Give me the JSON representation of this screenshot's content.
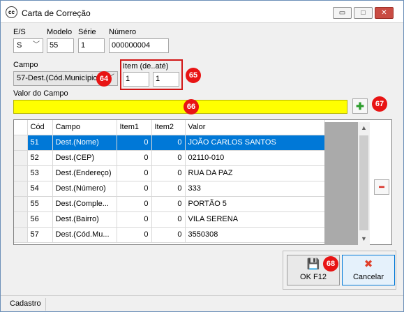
{
  "window": {
    "title": "Carta de Correção",
    "app_icon_text": "cc",
    "minimize_glyph": "▭",
    "maximize_glyph": "□",
    "close_glyph": "✕"
  },
  "header_fields": {
    "es_label": "E/S",
    "es_value": "S",
    "modelo_label": "Modelo",
    "modelo_value": "55",
    "serie_label": "Série",
    "serie_value": "1",
    "numero_label": "Número",
    "numero_value": "000000004"
  },
  "campo": {
    "label": "Campo",
    "value": "57-Dest.(Cód.Município)"
  },
  "item_range": {
    "label": "Item (de..até)",
    "from": "1",
    "to": "1"
  },
  "valor": {
    "label": "Valor do Campo",
    "value": ""
  },
  "badges": {
    "b64": "64",
    "b65": "65",
    "b66": "66",
    "b67": "67",
    "b68": "68"
  },
  "grid": {
    "columns": [
      "Cód",
      "Campo",
      "Item1",
      "Item2",
      "Valor"
    ],
    "rows": [
      {
        "cod": "51",
        "campo": "Dest.(Nome)",
        "item1": "0",
        "item2": "0",
        "valor": "JOÃO CARLOS SANTOS",
        "selected": true
      },
      {
        "cod": "52",
        "campo": "Dest.(CEP)",
        "item1": "0",
        "item2": "0",
        "valor": "02110-010",
        "selected": false
      },
      {
        "cod": "53",
        "campo": "Dest.(Endereço)",
        "item1": "0",
        "item2": "0",
        "valor": "RUA DA PAZ",
        "selected": false
      },
      {
        "cod": "54",
        "campo": "Dest.(Número)",
        "item1": "0",
        "item2": "0",
        "valor": "333",
        "selected": false
      },
      {
        "cod": "55",
        "campo": "Dest.(Comple...",
        "item1": "0",
        "item2": "0",
        "valor": "PORTÃO 5",
        "selected": false
      },
      {
        "cod": "56",
        "campo": "Dest.(Bairro)",
        "item1": "0",
        "item2": "0",
        "valor": "VILA SERENA",
        "selected": false
      },
      {
        "cod": "57",
        "campo": "Dest.(Cód.Mu...",
        "item1": "0",
        "item2": "0",
        "valor": "3550308",
        "selected": false
      }
    ]
  },
  "buttons": {
    "ok_label": "OK  F12",
    "cancel_label": "Cancelar",
    "add_glyph": "✚",
    "remove_glyph": "━",
    "save_glyph": "💾",
    "cancel_glyph": "✖"
  },
  "status_bar": {
    "tab_label": "Cadastro"
  },
  "colors": {
    "highlight_field": "#ffff00",
    "selected_row": "#0078d7",
    "badge": "#e81414",
    "add_green": "#2e9e2e",
    "remove_red": "#d9342b"
  }
}
